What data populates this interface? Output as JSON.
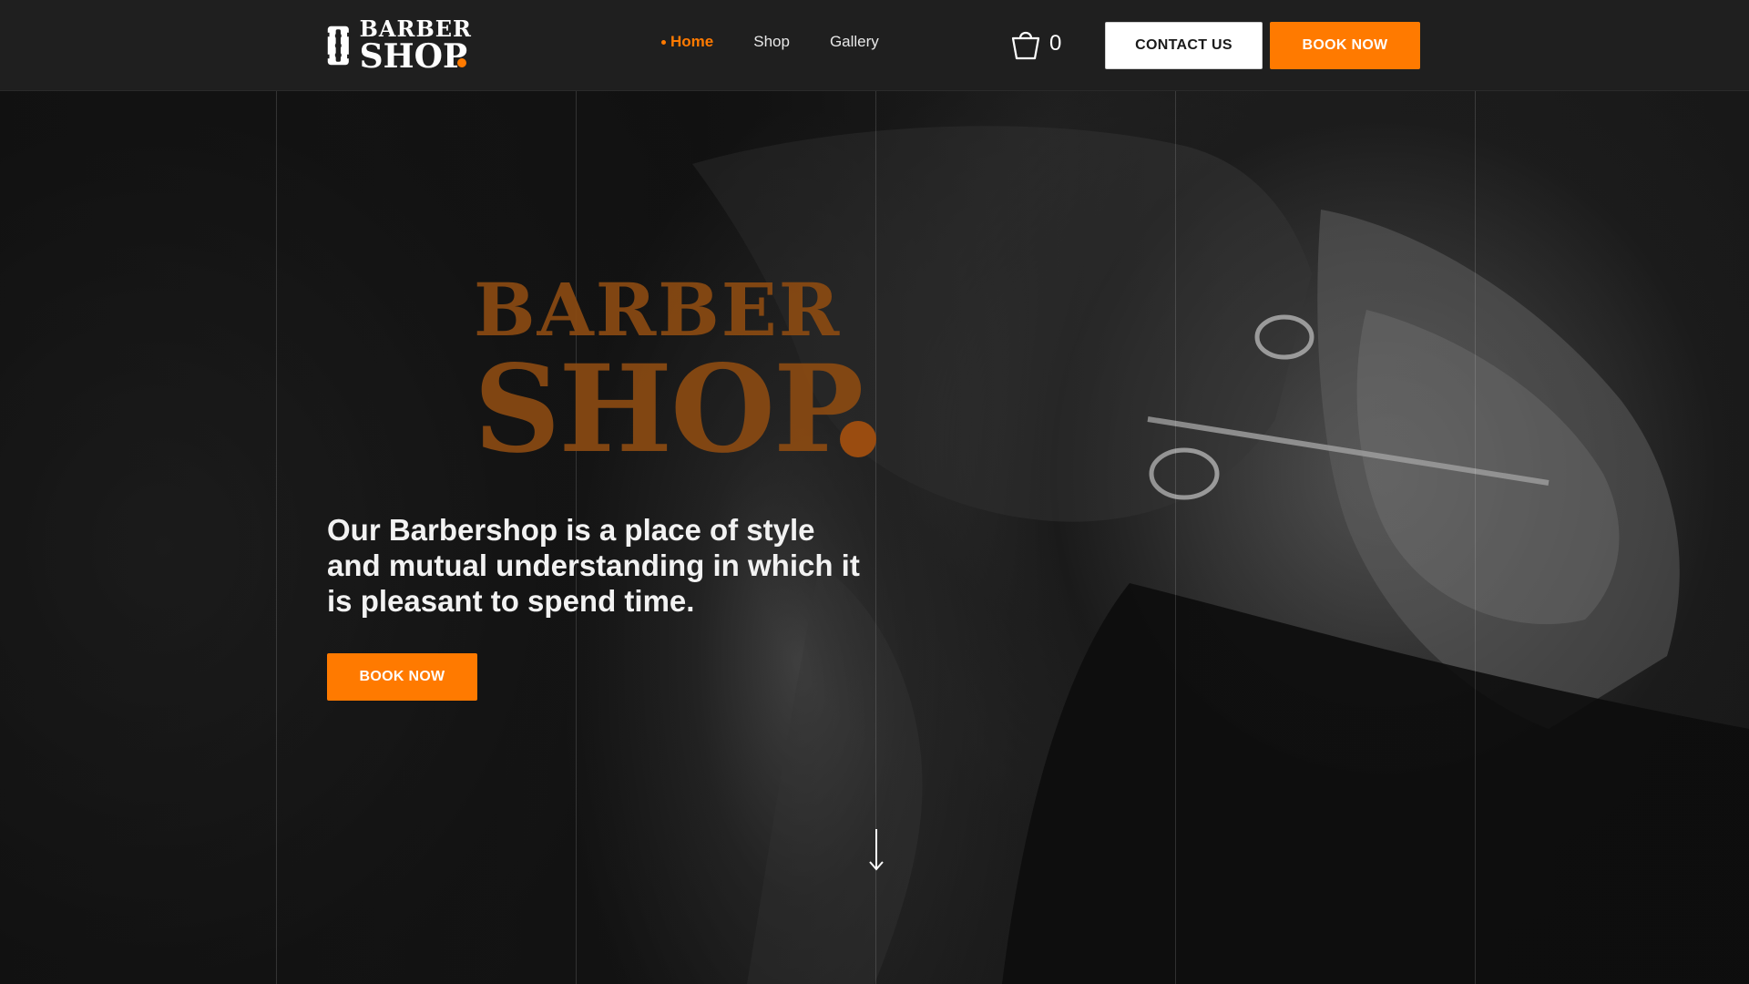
{
  "header": {
    "logo": {
      "line1": "BARBER",
      "line2": "SHOP"
    },
    "nav": [
      {
        "label": "Home",
        "active": true
      },
      {
        "label": "Shop",
        "active": false
      },
      {
        "label": "Gallery",
        "active": false
      }
    ],
    "cart": {
      "icon": "shopping-basket-icon",
      "count": "0"
    },
    "contact_label": "CONTACT US",
    "book_label": "BOOK NOW"
  },
  "hero": {
    "logo": {
      "line1": "BARBER",
      "line2": "SHOP"
    },
    "tagline": "Our Barbershop  is a place of style and mutual understanding in which it is pleasant to spend time.",
    "book_label": "BOOK NOW",
    "scroll_icon": "arrow-down-icon"
  },
  "colors": {
    "accent": "#ff7a00",
    "header_bg": "#1f1f1f",
    "hero_logo": "#8a4a12",
    "text": "#ffffff"
  }
}
